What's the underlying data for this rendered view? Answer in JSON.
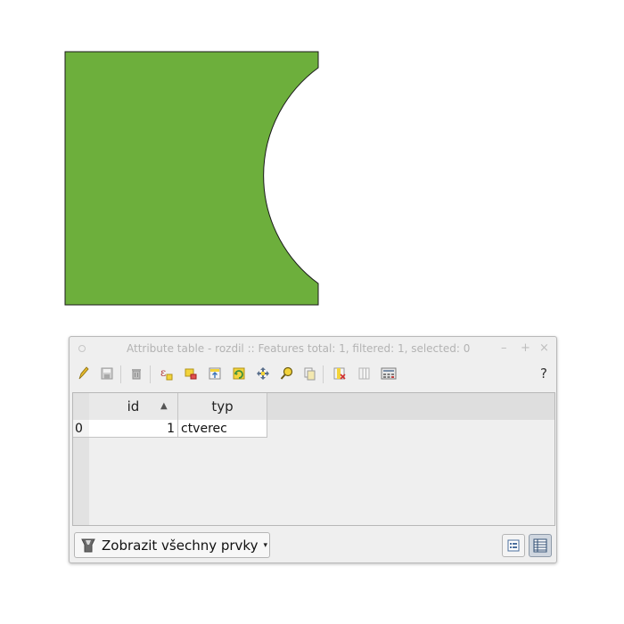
{
  "window": {
    "title": "Attribute table - rozdil :: Features total: 1, filtered: 1, selected: 0",
    "minimize": "–",
    "maximize": "+",
    "close": "×",
    "help": "?"
  },
  "toolbar": {
    "icons": [
      "pencil-icon",
      "save-icon",
      "delete-icon",
      "expression-icon",
      "select-by-expression-icon",
      "deselect-icon",
      "move-selection-top-icon",
      "invert-selection-icon",
      "pan-to-selected-icon",
      "zoom-to-selected-icon",
      "copy-icon",
      "delete-column-icon",
      "new-column-icon",
      "field-calculator-icon"
    ]
  },
  "table": {
    "columns": [
      {
        "label": "id",
        "sort": "▲"
      },
      {
        "label": "typ",
        "sort": ""
      }
    ],
    "rows": [
      {
        "header": "0",
        "id": "1",
        "typ": "ctverec"
      }
    ]
  },
  "footer": {
    "filter_label": "Zobrazit všechny prvky",
    "filter_arrow": "▾"
  },
  "colors": {
    "polygon_fill": "#6daf3c",
    "polygon_stroke": "#1a1a1a"
  }
}
